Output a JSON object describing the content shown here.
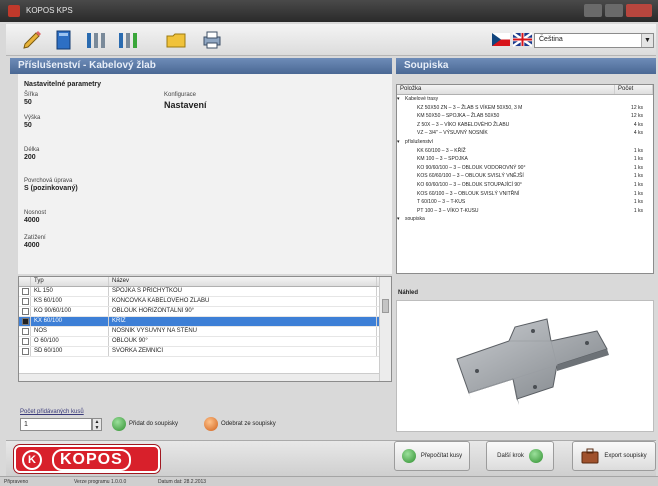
{
  "window": {
    "title": "KOPOS KPS"
  },
  "toolbar": {
    "buttons": [
      {
        "icon": "pencil-icon"
      },
      {
        "icon": "book-icon"
      },
      {
        "icon": "cable-tray-icon"
      },
      {
        "icon": "cable-tray-green-icon"
      },
      {
        "icon": "folder-icon"
      },
      {
        "icon": "printer-icon"
      }
    ],
    "language": {
      "selected": "Čeština",
      "flags": [
        "cz-flag",
        "gb-flag"
      ]
    }
  },
  "left_panel": {
    "header": "Příslušenství - Kabelový žlab",
    "form": {
      "heading": "Nastavitelné parametry",
      "fields": [
        {
          "label": "Šířka",
          "value": "50"
        },
        {
          "label": "Výška",
          "value": "50"
        },
        {
          "label": "Délka",
          "value": "200"
        },
        {
          "label": "Povrchová úprava",
          "value": "S (pozinkovaný)"
        },
        {
          "label": "Nosnost",
          "value": "4000"
        },
        {
          "label": "Zatížení",
          "value": "4000"
        }
      ],
      "right_label": "Konfigurace",
      "right_value": "Nastavení"
    },
    "table": {
      "columns": [
        "Typ",
        "Název"
      ],
      "rows": [
        {
          "typ": "KL 150",
          "nazev": "SPOJKA S PŘÍCHYTKOU",
          "checked": false,
          "selected": false
        },
        {
          "typ": "KS 60/100",
          "nazev": "KONCOVKA KABELOVÉHO ŽLABU",
          "checked": false,
          "selected": false
        },
        {
          "typ": "KO 90/60/100",
          "nazev": "OBLOUK HORIZONTÁLNÍ 90°",
          "checked": false,
          "selected": false
        },
        {
          "typ": "KX 60/100",
          "nazev": "KŘÍŽ",
          "checked": true,
          "selected": true
        },
        {
          "typ": "NOS",
          "nazev": "NOSNÍK VÝSUVNÝ NA STĚNU",
          "checked": false,
          "selected": false
        },
        {
          "typ": "O 60/100",
          "nazev": "OBLOUK 90°",
          "checked": false,
          "selected": false
        },
        {
          "typ": "SD 60/100",
          "nazev": "SVORKA ZEMNÍCÍ",
          "checked": false,
          "selected": false
        }
      ]
    },
    "quantity": {
      "label": "Počet přidávaných kusů",
      "value": "1"
    },
    "add_button": "Přidat do soupisky",
    "remove_button": "Odebrat ze soupisky"
  },
  "right_panel": {
    "header": "Soupiska",
    "tree": {
      "columns": [
        "Položka",
        "Počet"
      ],
      "rows": [
        {
          "level": 0,
          "text": "Kabelové trasy",
          "qty": ""
        },
        {
          "level": 1,
          "text": "KZ 50X50 ZN – 3 – ŽLAB S VÍKEM 50X50, 3 M",
          "qty": "12 ks"
        },
        {
          "level": 1,
          "text": "KM 50X50 – SPOJKA – ŽLAB 50X50",
          "qty": "12 ks"
        },
        {
          "level": 1,
          "text": "Z 50X – 3 – VÍKO KABELOVÉHO ŽLABU",
          "qty": "4 ks"
        },
        {
          "level": 1,
          "text": "VZ – 3/4\" – VÝSUVNÝ NOSNÍK",
          "qty": "4 ks"
        },
        {
          "level": 0,
          "text": "příslušenství",
          "qty": ""
        },
        {
          "level": 1,
          "text": "KK 60/100 – 3 – KŘÍŽ",
          "qty": "1 ks"
        },
        {
          "level": 1,
          "text": "KM 100 – 3 – SPOJKA",
          "qty": "1 ks"
        },
        {
          "level": 1,
          "text": "KO 90/60/100 – 3 – OBLOUK VODOROVNÝ 90°",
          "qty": "1 ks"
        },
        {
          "level": 1,
          "text": "KOS 60/60/100 – 3 – OBLOUK SVISLÝ VNĚJŠÍ",
          "qty": "1 ks"
        },
        {
          "level": 1,
          "text": "KO 60/60/100 – 3 – OBLOUK STOUPAJÍCÍ 90°",
          "qty": "1 ks"
        },
        {
          "level": 1,
          "text": "KOS 60/100 – 3 – OBLOUK SVISLÝ VNITŘNÍ",
          "qty": "1 ks"
        },
        {
          "level": 1,
          "text": "T 60/100 – 3 – T-KUS",
          "qty": "1 ks"
        },
        {
          "level": 1,
          "text": "PT 100 – 3 – VÍKO T-KUSU",
          "qty": "1 ks"
        },
        {
          "level": 0,
          "text": "soupiska",
          "qty": ""
        }
      ]
    },
    "detail_label": "Náhled",
    "buttons": {
      "recalc": "Přepočítat kusy",
      "next": "Další krok",
      "export": "Export soupisky"
    }
  },
  "logo": {
    "mark": "K",
    "word": "KOPOS"
  },
  "status": {
    "left": "Připraveno",
    "mid": "Verze programu 1.0.0.0",
    "right": "Datum dat: 28.2.2013"
  },
  "colors": {
    "header_blue": "#5a7aa8",
    "selection": "#3d7fd6",
    "brand_red": "#d8202b",
    "green_icon": "#3aa63a",
    "orange_icon": "#e67a1e"
  }
}
